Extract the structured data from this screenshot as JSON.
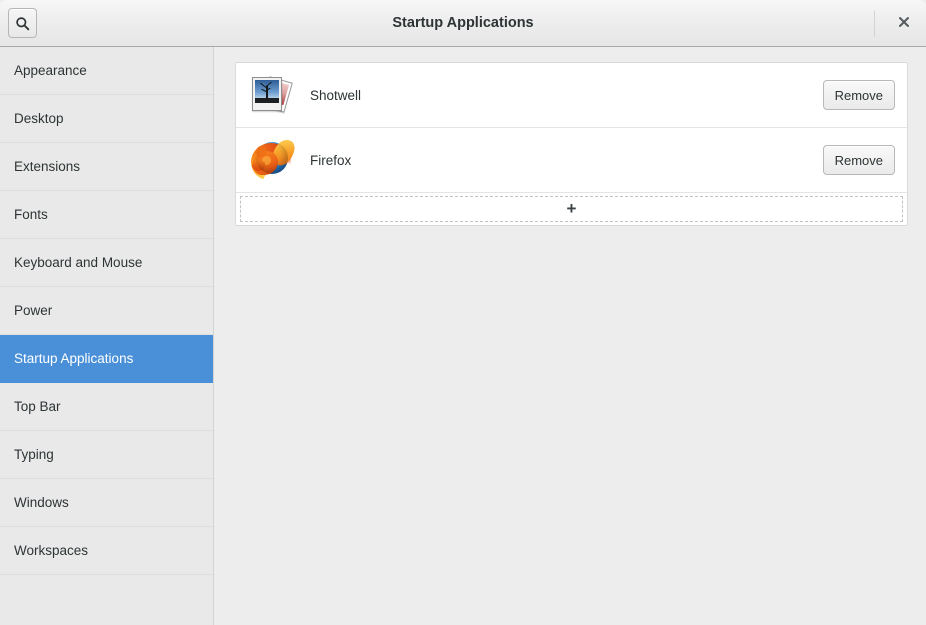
{
  "window": {
    "title": "Startup Applications",
    "search_icon": "search-icon",
    "close_label": "×"
  },
  "sidebar": {
    "items": [
      {
        "label": "Appearance",
        "selected": false
      },
      {
        "label": "Desktop",
        "selected": false
      },
      {
        "label": "Extensions",
        "selected": false
      },
      {
        "label": "Fonts",
        "selected": false
      },
      {
        "label": "Keyboard and Mouse",
        "selected": false
      },
      {
        "label": "Power",
        "selected": false
      },
      {
        "label": "Startup Applications",
        "selected": true
      },
      {
        "label": "Top Bar",
        "selected": false
      },
      {
        "label": "Typing",
        "selected": false
      },
      {
        "label": "Windows",
        "selected": false
      },
      {
        "label": "Workspaces",
        "selected": false
      }
    ],
    "selected_label": "Startup Applications",
    "selection_color": "#4a90d9",
    "background_color": "#e9e9e9"
  },
  "main": {
    "startup_apps": [
      {
        "name": "Shotwell",
        "icon": "shotwell-photos-icon",
        "remove_label": "Remove"
      },
      {
        "name": "Firefox",
        "icon": "firefox-icon",
        "remove_label": "Remove"
      }
    ],
    "add_row": {
      "plus_label": "+",
      "icon": "plus-icon"
    },
    "card_background": "#ffffff",
    "content_background": "#ededed"
  }
}
